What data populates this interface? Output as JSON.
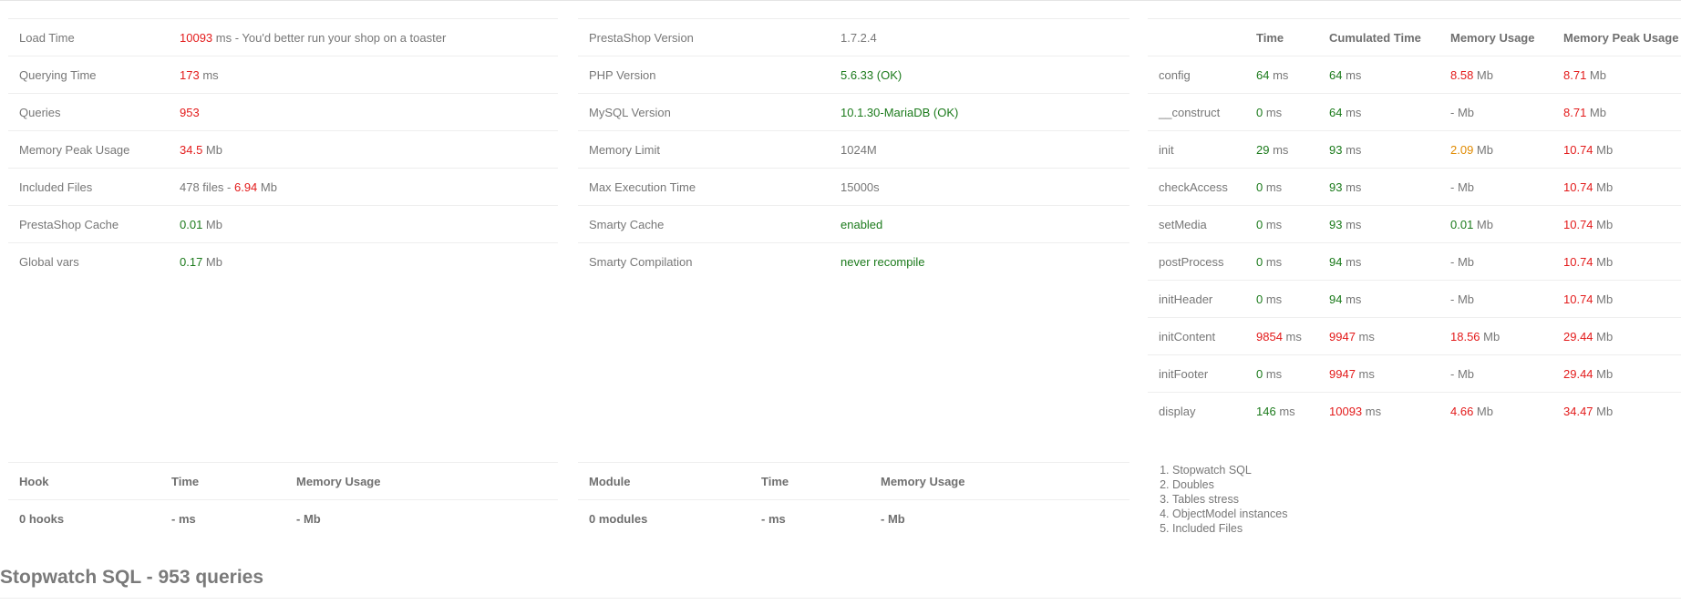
{
  "summary": [
    {
      "label": "Load Time",
      "value": "10093",
      "value_class": "red",
      "unit": "ms - You'd better run your shop on a toaster"
    },
    {
      "label": "Querying Time",
      "value": "173",
      "value_class": "red",
      "unit": "ms"
    },
    {
      "label": "Queries",
      "value": "953",
      "value_class": "red",
      "unit": ""
    },
    {
      "label": "Memory Peak Usage",
      "value": "34.5",
      "value_class": "red",
      "unit": "Mb"
    },
    {
      "label": "Included Files",
      "prefix": "478 files - ",
      "value": "6.94",
      "value_class": "red",
      "unit": "Mb"
    },
    {
      "label": "PrestaShop Cache",
      "value": "0.01",
      "value_class": "green",
      "unit": "Mb"
    },
    {
      "label": "Global vars",
      "value": "0.17",
      "value_class": "green",
      "unit": "Mb"
    }
  ],
  "config": [
    {
      "label": "PrestaShop Version",
      "value": "1.7.2.4",
      "value_class": ""
    },
    {
      "label": "PHP Version",
      "value": "5.6.33 (OK)",
      "value_class": "green"
    },
    {
      "label": "MySQL Version",
      "value": "10.1.30-MariaDB (OK)",
      "value_class": "green"
    },
    {
      "label": "Memory Limit",
      "value": "1024M",
      "value_class": ""
    },
    {
      "label": "Max Execution Time",
      "value": "15000s",
      "value_class": ""
    },
    {
      "label": "Smarty Cache",
      "value": "enabled",
      "value_class": "green"
    },
    {
      "label": "Smarty Compilation",
      "value": "never recompile",
      "value_class": "green"
    }
  ],
  "steps": {
    "headers": [
      "",
      "Time",
      "Cumulated Time",
      "Memory Usage",
      "Memory Peak Usage"
    ],
    "rows": [
      {
        "name": "config",
        "time": "64",
        "time_c": "green",
        "cum": "64",
        "cum_c": "green",
        "mem": "8.58",
        "mem_c": "red",
        "peak": "8.71",
        "peak_c": "red"
      },
      {
        "name": "__construct",
        "time": "0",
        "time_c": "green",
        "cum": "64",
        "cum_c": "green",
        "mem": "-",
        "mem_c": "",
        "peak": "8.71",
        "peak_c": "red"
      },
      {
        "name": "init",
        "time": "29",
        "time_c": "green",
        "cum": "93",
        "cum_c": "green",
        "mem": "2.09",
        "mem_c": "orange",
        "peak": "10.74",
        "peak_c": "red"
      },
      {
        "name": "checkAccess",
        "time": "0",
        "time_c": "green",
        "cum": "93",
        "cum_c": "green",
        "mem": "-",
        "mem_c": "",
        "peak": "10.74",
        "peak_c": "red"
      },
      {
        "name": "setMedia",
        "time": "0",
        "time_c": "green",
        "cum": "93",
        "cum_c": "green",
        "mem": "0.01",
        "mem_c": "green",
        "peak": "10.74",
        "peak_c": "red"
      },
      {
        "name": "postProcess",
        "time": "0",
        "time_c": "green",
        "cum": "94",
        "cum_c": "green",
        "mem": "-",
        "mem_c": "",
        "peak": "10.74",
        "peak_c": "red"
      },
      {
        "name": "initHeader",
        "time": "0",
        "time_c": "green",
        "cum": "94",
        "cum_c": "green",
        "mem": "-",
        "mem_c": "",
        "peak": "10.74",
        "peak_c": "red"
      },
      {
        "name": "initContent",
        "time": "9854",
        "time_c": "red",
        "cum": "9947",
        "cum_c": "red",
        "mem": "18.56",
        "mem_c": "red",
        "peak": "29.44",
        "peak_c": "red"
      },
      {
        "name": "initFooter",
        "time": "0",
        "time_c": "green",
        "cum": "9947",
        "cum_c": "red",
        "mem": "-",
        "mem_c": "",
        "peak": "29.44",
        "peak_c": "red"
      },
      {
        "name": "display",
        "time": "146",
        "time_c": "green",
        "cum": "10093",
        "cum_c": "red",
        "mem": "4.66",
        "mem_c": "red",
        "peak": "34.47",
        "peak_c": "red"
      }
    ],
    "ms": "ms",
    "mb": "Mb"
  },
  "hooks": {
    "headers": [
      "Hook",
      "Time",
      "Memory Usage"
    ],
    "row": [
      "0 hooks",
      "- ms",
      "- Mb"
    ]
  },
  "modules": {
    "headers": [
      "Module",
      "Time",
      "Memory Usage"
    ],
    "row": [
      "0 modules",
      "- ms",
      "- Mb"
    ]
  },
  "links": [
    "Stopwatch SQL",
    "Doubles",
    "Tables stress",
    "ObjectModel instances",
    "Included Files"
  ],
  "section_title": "Stopwatch SQL - 953 queries",
  "colors": {
    "red": "#e31b1b",
    "green": "#1b7a1b",
    "orange": "#e08a00",
    "text": "#777777"
  }
}
